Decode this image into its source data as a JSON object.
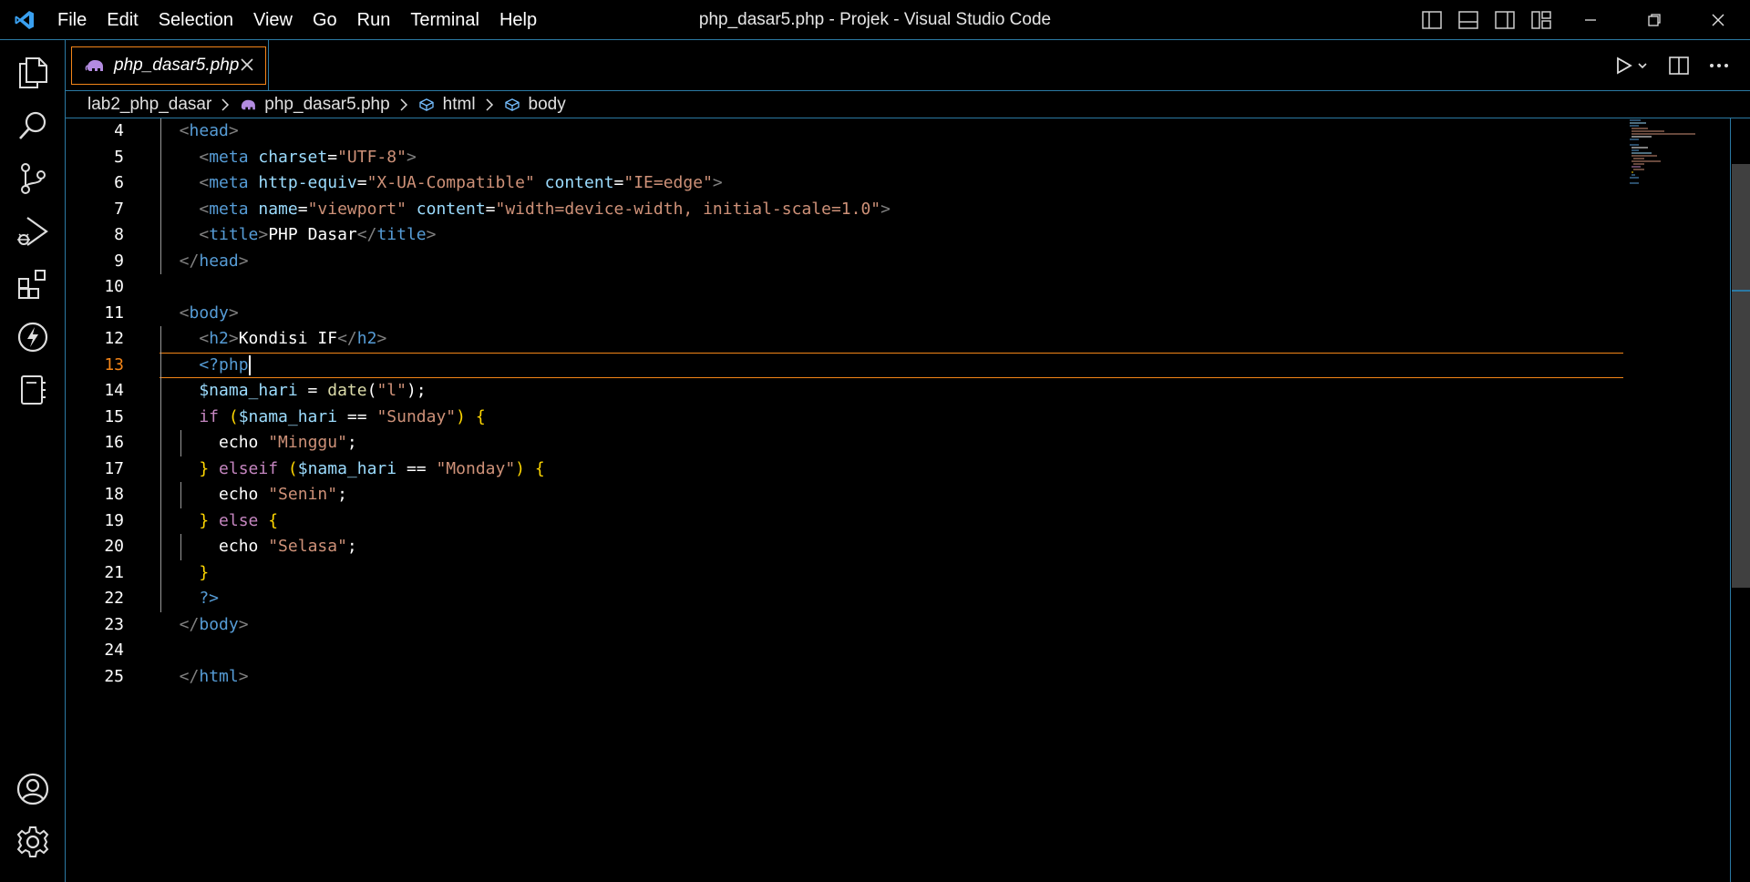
{
  "window": {
    "title": "php_dasar5.php - Projek - Visual Studio Code"
  },
  "menu": [
    "File",
    "Edit",
    "Selection",
    "View",
    "Go",
    "Run",
    "Terminal",
    "Help"
  ],
  "activity_bar": {
    "top_icons": [
      "explorer-icon",
      "search-icon",
      "source-control-icon",
      "run-debug-icon",
      "extensions-icon",
      "lightning-icon",
      "notebook-icon"
    ],
    "bottom_icons": [
      "account-icon",
      "settings-gear-icon"
    ]
  },
  "tab": {
    "label": "php_dasar5.php",
    "icon": "php-elephant-icon"
  },
  "breadcrumb": [
    "lab2_php_dasar",
    "php_dasar5.php",
    "html",
    "body"
  ],
  "editor": {
    "current_line": 13,
    "lines": [
      {
        "n": "4",
        "seg": [
          [
            "t-tag",
            "  <"
          ],
          [
            "t-name",
            "head"
          ],
          [
            "t-tag",
            ">"
          ]
        ]
      },
      {
        "n": "5",
        "seg": [
          [
            "t-tag",
            "    <"
          ],
          [
            "t-name",
            "meta "
          ],
          [
            "t-attr",
            "charset"
          ],
          [
            "t-text",
            "="
          ],
          [
            "t-str",
            "\"UTF-8\""
          ],
          [
            "t-tag",
            ">"
          ]
        ]
      },
      {
        "n": "6",
        "seg": [
          [
            "t-tag",
            "    <"
          ],
          [
            "t-name",
            "meta "
          ],
          [
            "t-attr",
            "http-equiv"
          ],
          [
            "t-text",
            "="
          ],
          [
            "t-str",
            "\"X-UA-Compatible\" "
          ],
          [
            "t-attr",
            "content"
          ],
          [
            "t-text",
            "="
          ],
          [
            "t-str",
            "\"IE=edge\""
          ],
          [
            "t-tag",
            ">"
          ]
        ]
      },
      {
        "n": "7",
        "seg": [
          [
            "t-tag",
            "    <"
          ],
          [
            "t-name",
            "meta "
          ],
          [
            "t-attr",
            "name"
          ],
          [
            "t-text",
            "="
          ],
          [
            "t-str",
            "\"viewport\" "
          ],
          [
            "t-attr",
            "content"
          ],
          [
            "t-text",
            "="
          ],
          [
            "t-str",
            "\"width=device-width, initial-scale=1.0\""
          ],
          [
            "t-tag",
            ">"
          ]
        ]
      },
      {
        "n": "8",
        "seg": [
          [
            "t-tag",
            "    <"
          ],
          [
            "t-name",
            "title"
          ],
          [
            "t-tag",
            ">"
          ],
          [
            "t-text",
            "PHP Dasar"
          ],
          [
            "t-tag",
            "</"
          ],
          [
            "t-name",
            "title"
          ],
          [
            "t-tag",
            ">"
          ]
        ]
      },
      {
        "n": "9",
        "seg": [
          [
            "t-tag",
            "  </"
          ],
          [
            "t-name",
            "head"
          ],
          [
            "t-tag",
            ">"
          ]
        ]
      },
      {
        "n": "10",
        "seg": [
          [
            "t-text",
            ""
          ]
        ]
      },
      {
        "n": "11",
        "seg": [
          [
            "t-tag",
            "  <"
          ],
          [
            "t-name",
            "body"
          ],
          [
            "t-tag",
            ">"
          ]
        ]
      },
      {
        "n": "12",
        "seg": [
          [
            "t-tag",
            "    <"
          ],
          [
            "t-name",
            "h2"
          ],
          [
            "t-tag",
            ">"
          ],
          [
            "t-text",
            "Kondisi IF"
          ],
          [
            "t-tag",
            "</"
          ],
          [
            "t-name",
            "h2"
          ],
          [
            "t-tag",
            ">"
          ]
        ]
      },
      {
        "n": "13",
        "seg": [
          [
            "t-php",
            "    <?php"
          ]
        ]
      },
      {
        "n": "14",
        "seg": [
          [
            "t-var",
            "    $nama_hari"
          ],
          [
            "t-text",
            " = "
          ],
          [
            "t-fn",
            "date"
          ],
          [
            "t-text",
            "("
          ],
          [
            "t-str",
            "\"l\""
          ],
          [
            "t-text",
            ");"
          ]
        ]
      },
      {
        "n": "15",
        "seg": [
          [
            "t-kw",
            "    if "
          ],
          [
            "t-br",
            "("
          ],
          [
            "t-var",
            "$nama_hari"
          ],
          [
            "t-text",
            " == "
          ],
          [
            "t-str",
            "\"Sunday\""
          ],
          [
            "t-br",
            ") {"
          ]
        ]
      },
      {
        "n": "16",
        "seg": [
          [
            "t-text",
            "      echo "
          ],
          [
            "t-str",
            "\"Minggu\""
          ],
          [
            "t-text",
            ";"
          ]
        ]
      },
      {
        "n": "17",
        "seg": [
          [
            "t-br",
            "    } "
          ],
          [
            "t-kw",
            "elseif "
          ],
          [
            "t-br",
            "("
          ],
          [
            "t-var",
            "$nama_hari"
          ],
          [
            "t-text",
            " == "
          ],
          [
            "t-str",
            "\"Monday\""
          ],
          [
            "t-br",
            ") {"
          ]
        ]
      },
      {
        "n": "18",
        "seg": [
          [
            "t-text",
            "      echo "
          ],
          [
            "t-str",
            "\"Senin\""
          ],
          [
            "t-text",
            ";"
          ]
        ]
      },
      {
        "n": "19",
        "seg": [
          [
            "t-br",
            "    } "
          ],
          [
            "t-kw",
            "else "
          ],
          [
            "t-br",
            "{"
          ]
        ]
      },
      {
        "n": "20",
        "seg": [
          [
            "t-text",
            "      echo "
          ],
          [
            "t-str",
            "\"Selasa\""
          ],
          [
            "t-text",
            ";"
          ]
        ]
      },
      {
        "n": "21",
        "seg": [
          [
            "t-br",
            "    }"
          ]
        ]
      },
      {
        "n": "22",
        "seg": [
          [
            "t-php",
            "    ?>"
          ]
        ]
      },
      {
        "n": "23",
        "seg": [
          [
            "t-tag",
            "  </"
          ],
          [
            "t-name",
            "body"
          ],
          [
            "t-tag",
            ">"
          ]
        ]
      },
      {
        "n": "24",
        "seg": [
          [
            "t-text",
            ""
          ]
        ]
      },
      {
        "n": "25",
        "seg": [
          [
            "t-tag",
            "  </"
          ],
          [
            "t-name",
            "html"
          ],
          [
            "t-tag",
            ">"
          ]
        ]
      }
    ]
  },
  "colors": {
    "accent_border": "#2b79a3",
    "active_tab_border": "#f38518",
    "background": "#000000"
  }
}
